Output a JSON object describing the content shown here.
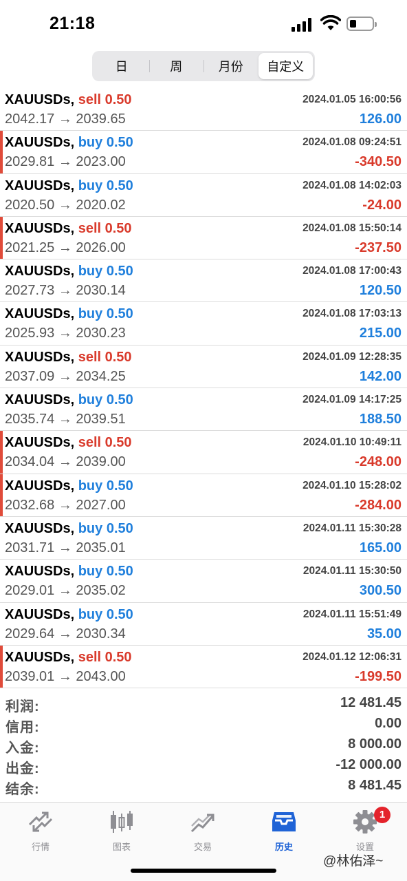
{
  "status": {
    "time": "21:18"
  },
  "periods": [
    {
      "label": "日",
      "active": false
    },
    {
      "label": "周",
      "active": false
    },
    {
      "label": "月份",
      "active": false
    },
    {
      "label": "自定义",
      "active": true
    }
  ],
  "trades": [
    {
      "symbol": "XAUUSDs,",
      "side": "sell 0.50",
      "type": "sell",
      "datetime": "2024.01.05 16:00:56",
      "prices": "2042.17 → 2039.65",
      "profit": "126.00",
      "loss": false
    },
    {
      "symbol": "XAUUSDs,",
      "side": "buy 0.50",
      "type": "buy",
      "datetime": "2024.01.08 09:24:51",
      "prices": "2029.81 → 2023.00",
      "profit": "-340.50",
      "loss": true
    },
    {
      "symbol": "XAUUSDs,",
      "side": "buy 0.50",
      "type": "buy",
      "datetime": "2024.01.08 14:02:03",
      "prices": "2020.50 → 2020.02",
      "profit": "-24.00",
      "loss": false
    },
    {
      "symbol": "XAUUSDs,",
      "side": "sell 0.50",
      "type": "sell",
      "datetime": "2024.01.08 15:50:14",
      "prices": "2021.25 → 2026.00",
      "profit": "-237.50",
      "loss": true
    },
    {
      "symbol": "XAUUSDs,",
      "side": "buy 0.50",
      "type": "buy",
      "datetime": "2024.01.08 17:00:43",
      "prices": "2027.73 → 2030.14",
      "profit": "120.50",
      "loss": false
    },
    {
      "symbol": "XAUUSDs,",
      "side": "buy 0.50",
      "type": "buy",
      "datetime": "2024.01.08 17:03:13",
      "prices": "2025.93 → 2030.23",
      "profit": "215.00",
      "loss": false
    },
    {
      "symbol": "XAUUSDs,",
      "side": "sell 0.50",
      "type": "sell",
      "datetime": "2024.01.09 12:28:35",
      "prices": "2037.09 → 2034.25",
      "profit": "142.00",
      "loss": false
    },
    {
      "symbol": "XAUUSDs,",
      "side": "buy 0.50",
      "type": "buy",
      "datetime": "2024.01.09 14:17:25",
      "prices": "2035.74 → 2039.51",
      "profit": "188.50",
      "loss": false
    },
    {
      "symbol": "XAUUSDs,",
      "side": "sell 0.50",
      "type": "sell",
      "datetime": "2024.01.10 10:49:11",
      "prices": "2034.04 → 2039.00",
      "profit": "-248.00",
      "loss": true
    },
    {
      "symbol": "XAUUSDs,",
      "side": "buy 0.50",
      "type": "buy",
      "datetime": "2024.01.10 15:28:02",
      "prices": "2032.68 → 2027.00",
      "profit": "-284.00",
      "loss": true
    },
    {
      "symbol": "XAUUSDs,",
      "side": "buy 0.50",
      "type": "buy",
      "datetime": "2024.01.11 15:30:28",
      "prices": "2031.71 → 2035.01",
      "profit": "165.00",
      "loss": false
    },
    {
      "symbol": "XAUUSDs,",
      "side": "buy 0.50",
      "type": "buy",
      "datetime": "2024.01.11 15:30:50",
      "prices": "2029.01 → 2035.02",
      "profit": "300.50",
      "loss": false
    },
    {
      "symbol": "XAUUSDs,",
      "side": "buy 0.50",
      "type": "buy",
      "datetime": "2024.01.11 15:51:49",
      "prices": "2029.64 → 2030.34",
      "profit": "35.00",
      "loss": false
    },
    {
      "symbol": "XAUUSDs,",
      "side": "sell 0.50",
      "type": "sell",
      "datetime": "2024.01.12 12:06:31",
      "prices": "2039.01 → 2043.00",
      "profit": "-199.50",
      "loss": true
    }
  ],
  "summary": [
    {
      "label": "利润:",
      "value": "12 481.45"
    },
    {
      "label": "信用:",
      "value": "0.00"
    },
    {
      "label": "入金:",
      "value": "8 000.00"
    },
    {
      "label": "出金:",
      "value": "-12 000.00"
    },
    {
      "label": "结余:",
      "value": "8 481.45"
    }
  ],
  "tabs": [
    {
      "label": "行情",
      "icon": "quotes-icon",
      "active": false
    },
    {
      "label": "图表",
      "icon": "chart-candles-icon",
      "active": false
    },
    {
      "label": "交易",
      "icon": "trade-icon",
      "active": false
    },
    {
      "label": "历史",
      "icon": "history-icon",
      "active": true
    },
    {
      "label": "设置",
      "icon": "settings-icon",
      "active": false,
      "badge": "1"
    }
  ],
  "watermark": "@林佑泽~",
  "colors": {
    "profit": "#1f7fdc",
    "loss": "#d93a2b",
    "accent": "#1f63d6",
    "badge": "#e4232b"
  }
}
